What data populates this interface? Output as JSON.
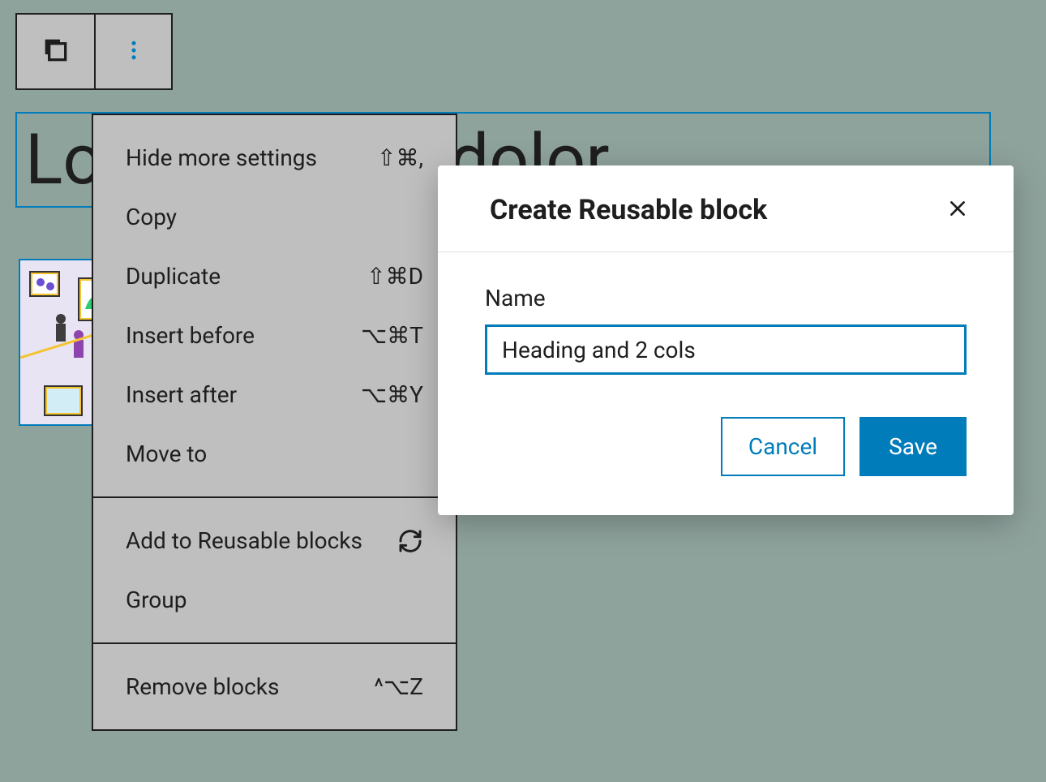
{
  "toolbar": {
    "copy_icon_name": "copy-icon",
    "more_icon_name": "more-vertical-icon"
  },
  "heading": {
    "text": "Lorem ipsum dolor"
  },
  "menu": {
    "sections": [
      {
        "items": [
          {
            "label": "Hide more settings",
            "shortcut": "⇧⌘,"
          },
          {
            "label": "Copy",
            "shortcut": ""
          },
          {
            "label": "Duplicate",
            "shortcut": "⇧⌘D"
          },
          {
            "label": "Insert before",
            "shortcut": "⌥⌘T"
          },
          {
            "label": "Insert after",
            "shortcut": "⌥⌘Y"
          },
          {
            "label": "Move to",
            "shortcut": ""
          }
        ]
      },
      {
        "items": [
          {
            "label": "Add to Reusable blocks",
            "icon": "reusable-icon"
          },
          {
            "label": "Group",
            "shortcut": ""
          }
        ]
      },
      {
        "items": [
          {
            "label": "Remove blocks",
            "shortcut": "^⌥Z"
          }
        ]
      }
    ]
  },
  "modal": {
    "title": "Create Reusable block",
    "name_label": "Name",
    "name_value": "Heading and 2 cols",
    "cancel_label": "Cancel",
    "save_label": "Save"
  }
}
